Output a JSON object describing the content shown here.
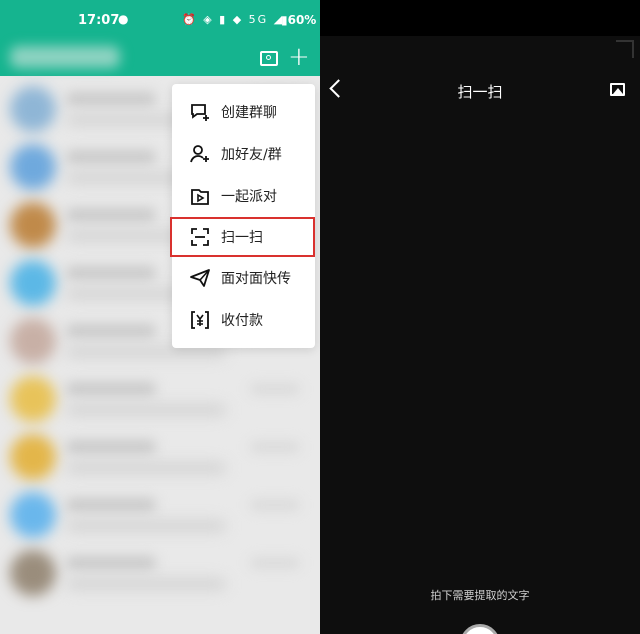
{
  "status_bar": {
    "time": "17:07",
    "signal_text": "⏰ ◈ ▮ ◆ 5G ◢",
    "battery": "▮60%"
  },
  "menu": {
    "items": [
      {
        "label": "创建群聊",
        "icon": "new-group-chat-icon"
      },
      {
        "label": "加好友/群",
        "icon": "add-friend-icon"
      },
      {
        "label": "一起派对",
        "icon": "party-icon"
      },
      {
        "label": "扫一扫",
        "icon": "scan-icon",
        "highlighted": true
      },
      {
        "label": "面对面快传",
        "icon": "send-plane-icon"
      },
      {
        "label": "收付款",
        "icon": "payment-icon"
      }
    ]
  },
  "scanner": {
    "title": "扫一扫",
    "hint": "拍下需要提取的文字"
  },
  "colors": {
    "brand": "#15b48f",
    "highlight_border": "#d9312e",
    "scanner_bg": "#0e0e0e"
  },
  "chat_list": {
    "avatar_colors": [
      "#8fb6d6",
      "#6fa9dd",
      "#c08a4a",
      "#5cb8e6",
      "#c8b0a6",
      "#e8c35a",
      "#e3b64a",
      "#6ab7ec",
      "#9a8d7c"
    ]
  }
}
